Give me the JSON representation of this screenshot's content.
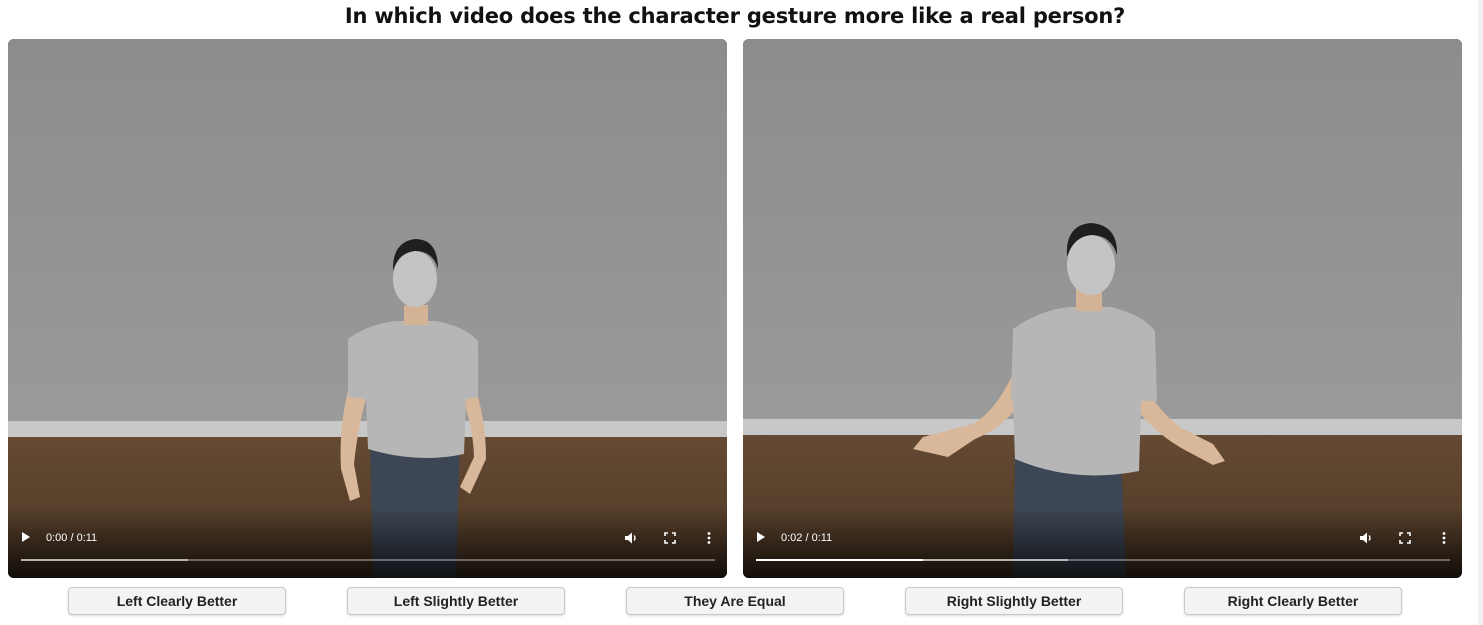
{
  "question": "In which video does the character gesture more like a real person?",
  "videos": [
    {
      "id": "left",
      "time_display": "0:00 / 0:11",
      "played_fraction": 0.0,
      "buffered_fraction": 0.24,
      "paused": true
    },
    {
      "id": "right",
      "time_display": "0:02 / 0:11",
      "played_fraction": 0.24,
      "buffered_fraction": 0.45,
      "paused": true
    }
  ],
  "icons": {
    "play": "play-icon",
    "volume": "volume-icon",
    "fullscreen": "fullscreen-icon",
    "menu": "more-vertical-icon"
  },
  "choices": [
    {
      "label": "Left Clearly Better"
    },
    {
      "label": "Left Slightly Better"
    },
    {
      "label": "They Are Equal"
    },
    {
      "label": "Right Slightly Better"
    },
    {
      "label": "Right Clearly Better"
    }
  ],
  "colors": {
    "wall": "#8e8e8e",
    "floor": "#6b5038",
    "baseboard": "#c8c8c8",
    "shirt": "#b4b4b4",
    "skin": "#d9b79a",
    "jeans": "#3d4654",
    "hair": "#1f1f1f"
  }
}
